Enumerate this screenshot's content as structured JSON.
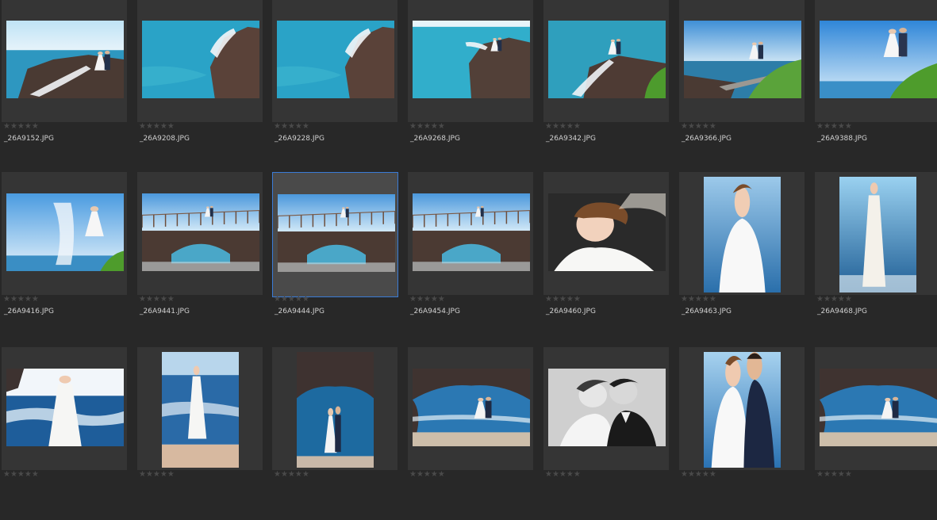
{
  "grid": {
    "rows": [
      [
        {
          "filename": "_26A9152.JPG",
          "rating": 0,
          "orientation": "landscape",
          "scene": "sea-cliff-veil-wide"
        },
        {
          "filename": "_26A9208.JPG",
          "rating": 0,
          "orientation": "landscape",
          "scene": "sea-cliff-veil-right"
        },
        {
          "filename": "_26A9228.JPG",
          "rating": 0,
          "orientation": "landscape",
          "scene": "sea-cliff-veil-right"
        },
        {
          "filename": "_26A9268.JPG",
          "rating": 0,
          "orientation": "landscape",
          "scene": "sea-cliff-couple-right"
        },
        {
          "filename": "_26A9342.JPG",
          "rating": 0,
          "orientation": "landscape",
          "scene": "sea-cliff-couple-plants"
        },
        {
          "filename": "_26A9366.JPG",
          "rating": 0,
          "orientation": "landscape",
          "scene": "boardwalk-couple"
        },
        {
          "filename": "_26A9388.JPG",
          "rating": 0,
          "orientation": "landscape",
          "scene": "sky-couple-plants"
        }
      ],
      [
        {
          "filename": "_26A9416.JPG",
          "rating": 0,
          "orientation": "landscape",
          "scene": "sky-bride-veil"
        },
        {
          "filename": "_26A9441.JPG",
          "rating": 0,
          "orientation": "landscape",
          "scene": "rock-arch-bridge"
        },
        {
          "filename": "_26A9444.JPG",
          "rating": 0,
          "orientation": "landscape",
          "scene": "rock-arch-bridge",
          "selected": true
        },
        {
          "filename": "_26A9454.JPG",
          "rating": 0,
          "orientation": "landscape",
          "scene": "rock-arch-bridge"
        },
        {
          "filename": "_26A9460.JPG",
          "rating": 0,
          "orientation": "landscape",
          "scene": "bride-portrait-dark"
        },
        {
          "filename": "_26A9463.JPG",
          "rating": 0,
          "orientation": "portrait",
          "scene": "bride-portrait-sea"
        },
        {
          "filename": "_26A9468.JPG",
          "rating": 0,
          "orientation": "portrait",
          "scene": "bride-standing-sea"
        }
      ],
      [
        {
          "filename": "",
          "rating": 0,
          "orientation": "landscape",
          "scene": "bride-waves"
        },
        {
          "filename": "",
          "rating": 0,
          "orientation": "portrait",
          "scene": "bride-waves-portrait"
        },
        {
          "filename": "",
          "rating": 0,
          "orientation": "portrait",
          "scene": "cave-couple-portrait"
        },
        {
          "filename": "",
          "rating": 0,
          "orientation": "landscape",
          "scene": "cave-couple"
        },
        {
          "filename": "",
          "rating": 0,
          "orientation": "landscape",
          "scene": "bw-couple"
        },
        {
          "filename": "",
          "rating": 0,
          "orientation": "portrait",
          "scene": "couple-portrait-sea"
        },
        {
          "filename": "",
          "rating": 0,
          "orientation": "landscape",
          "scene": "cave-couple"
        }
      ]
    ]
  },
  "rating_symbol": "★★★★★",
  "colors": {
    "background": "#282828",
    "cell": "#353535",
    "selected_cell": "#4a4a4a",
    "selection_border": "#3a7bd5",
    "filename_text": "#d0d0d0",
    "star_empty": "#4a4a4a"
  }
}
